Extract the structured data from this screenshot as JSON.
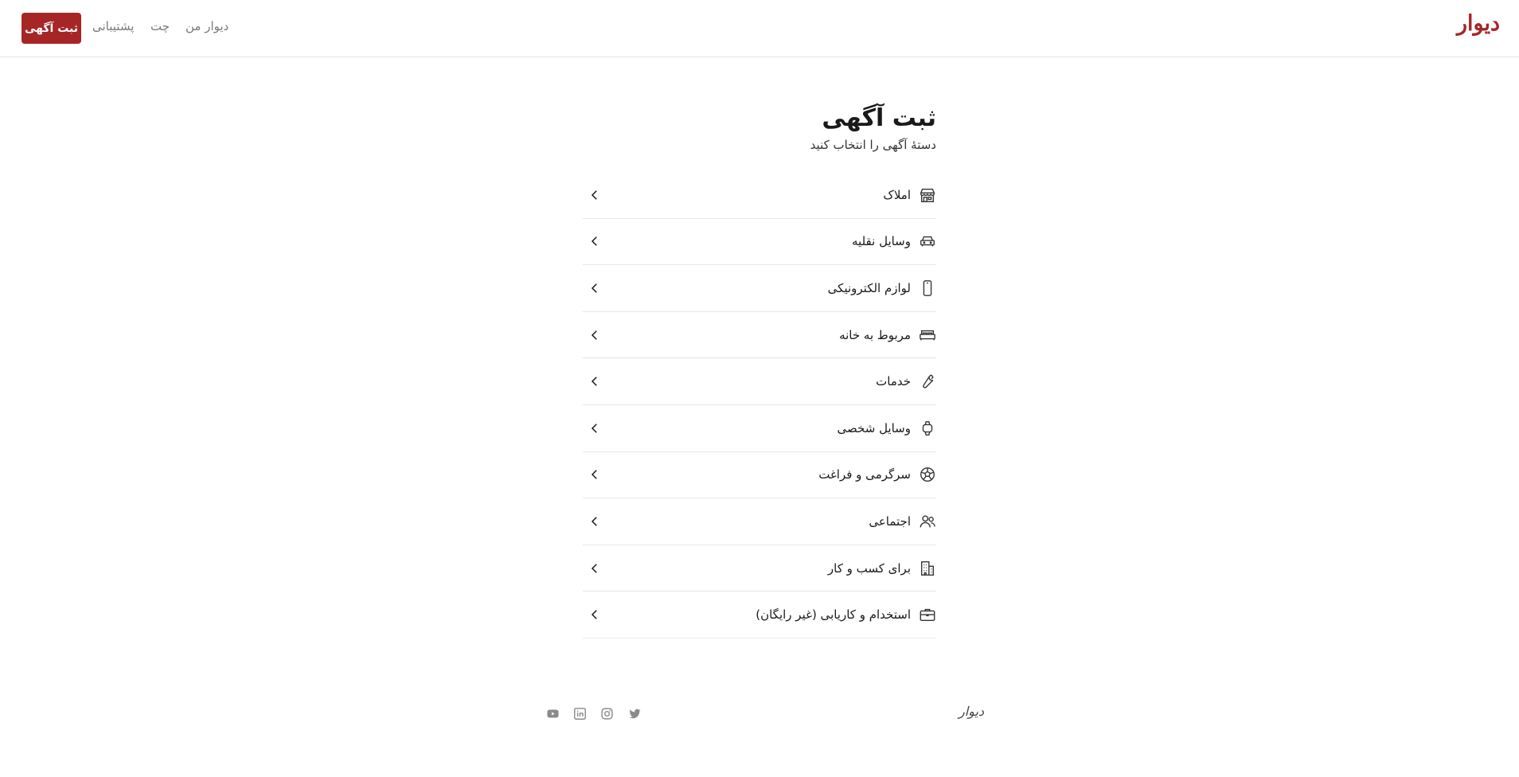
{
  "header": {
    "logo": "دیوار",
    "nav": {
      "my_divar": "دیوار من",
      "chat": "چت",
      "support": "پشتیبانی"
    },
    "post_ad_label": "ثبت آگهی",
    "accent_color": "#a62626"
  },
  "main": {
    "title": "ثبت آگهی",
    "subtitle": "دستهٔ آگهی را انتخاب کنید",
    "categories": [
      {
        "label": "املاک",
        "icon": "store-icon"
      },
      {
        "label": "وسایل نقلیه",
        "icon": "car-icon"
      },
      {
        "label": "لوازم الکترونیکی",
        "icon": "phone-icon"
      },
      {
        "label": "مربوط به خانه",
        "icon": "bed-icon"
      },
      {
        "label": "خدمات",
        "icon": "wrench-icon"
      },
      {
        "label": "وسایل شخصی",
        "icon": "watch-icon"
      },
      {
        "label": "سرگرمی و فراغت",
        "icon": "ball-icon"
      },
      {
        "label": "اجتماعی",
        "icon": "people-icon"
      },
      {
        "label": "برای کسب و کار",
        "icon": "building-icon"
      },
      {
        "label": "استخدام و کاریابی (غیر رایگان)",
        "icon": "briefcase-icon"
      }
    ]
  },
  "footer": {
    "brand": "دیوار",
    "social": [
      "youtube-icon",
      "linkedin-icon",
      "instagram-icon",
      "twitter-icon"
    ]
  }
}
